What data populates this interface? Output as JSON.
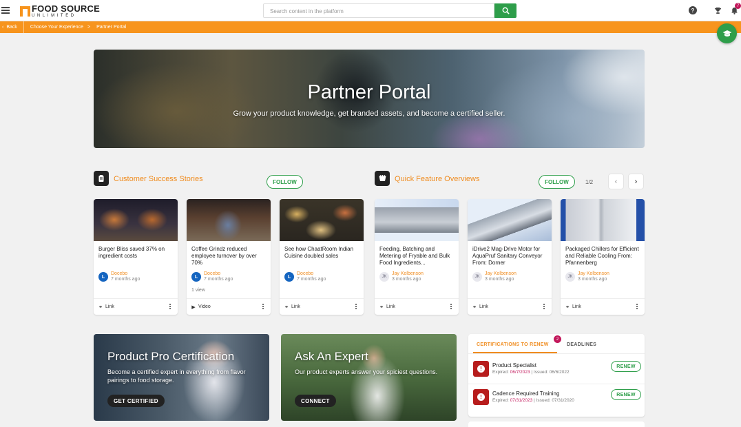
{
  "brand": {
    "name_top": "FOOD SOURCE",
    "name_bottom": "UNLIMITED"
  },
  "header": {
    "search_placeholder": "Search content in the platform",
    "notification_count": "7",
    "help_glyph": "?"
  },
  "breadcrumb": {
    "back": "Back",
    "items": [
      "Choose Your Experience",
      "Partner Portal"
    ],
    "separator": ">"
  },
  "hero": {
    "title": "Partner Portal",
    "subtitle": "Grow your product knowledge, get branded assets, and become a certified seller."
  },
  "sections": {
    "customer_success": {
      "title": "Customer Success Stories",
      "follow": "FOLLOW"
    },
    "quick_features": {
      "title": "Quick Feature Overviews",
      "follow": "FOLLOW",
      "pager": "1/2"
    }
  },
  "cards": [
    {
      "title": "Burger Bliss saved 37% on ingredient costs",
      "author": "Docebo",
      "time": "7 months ago",
      "avatar": "L",
      "views": "",
      "type": "Link"
    },
    {
      "title": "Coffee Grindz reduced employee turnover by over 70%",
      "author": "Docebo",
      "time": "7 months ago",
      "avatar": "L",
      "views": "1 view",
      "type": "Video"
    },
    {
      "title": "See how ChaatRoom Indian Cuisine doubled sales",
      "author": "Docebo",
      "time": "7 months ago",
      "avatar": "L",
      "views": "",
      "type": "Link"
    },
    {
      "title": "Feeding, Batching and Metering of Fryable and Bulk Food Ingredients...",
      "author": "Jay Kolbenson",
      "time": "3 months ago",
      "avatar": "JK",
      "views": "",
      "type": "Link"
    },
    {
      "title": "iDrive2 Mag-Drive Motor for AquaPruf Sanitary Conveyor From: Dorner",
      "author": "Jay Kolbenson",
      "time": "3 months ago",
      "avatar": "JK",
      "views": "",
      "type": "Link"
    },
    {
      "title": "Packaged Chillers for Efficient and Reliable Cooling From: Pfannenberg",
      "author": "Jay Kolbenson",
      "time": "3 months ago",
      "avatar": "JK",
      "views": "",
      "type": "Link"
    }
  ],
  "promos": [
    {
      "title": "Product Pro Certification",
      "desc": "Become a certified expert in everything from flavor pairings to food storage.",
      "button": "GET CERTIFIED"
    },
    {
      "title": "Ask An Expert",
      "desc": "Our product experts answer your spiciest questions.",
      "button": "CONNECT"
    }
  ],
  "certifications": {
    "tab_active": "CERTIFICATIONS TO RENEW",
    "tab_badge": "2",
    "tab_inactive": "DEADLINES",
    "items": [
      {
        "name": "Product Specialist",
        "expired_label": "Expired:",
        "expired": "06/7/2023",
        "issued_label": "Issued:",
        "issued": "06/6/2022",
        "action": "RENEW"
      },
      {
        "name": "Cadence Required Training",
        "expired_label": "Expired:",
        "expired": "07/31/2023",
        "issued_label": "Issued:",
        "issued": "07/31/2020",
        "action": "RENEW"
      }
    ]
  },
  "icons": [
    "menu-icon",
    "search-icon",
    "help-icon",
    "trophy-icon",
    "bell-icon",
    "graduation-cap-icon",
    "document-icon",
    "bucket-icon",
    "link-icon",
    "video-icon",
    "more-icon",
    "chevron-left-icon",
    "chevron-right-icon",
    "alert-icon"
  ],
  "colors": {
    "accent": "#f7941d",
    "primary": "#2e9e4a",
    "badge": "#c2185b",
    "alert": "#b71c1c"
  }
}
